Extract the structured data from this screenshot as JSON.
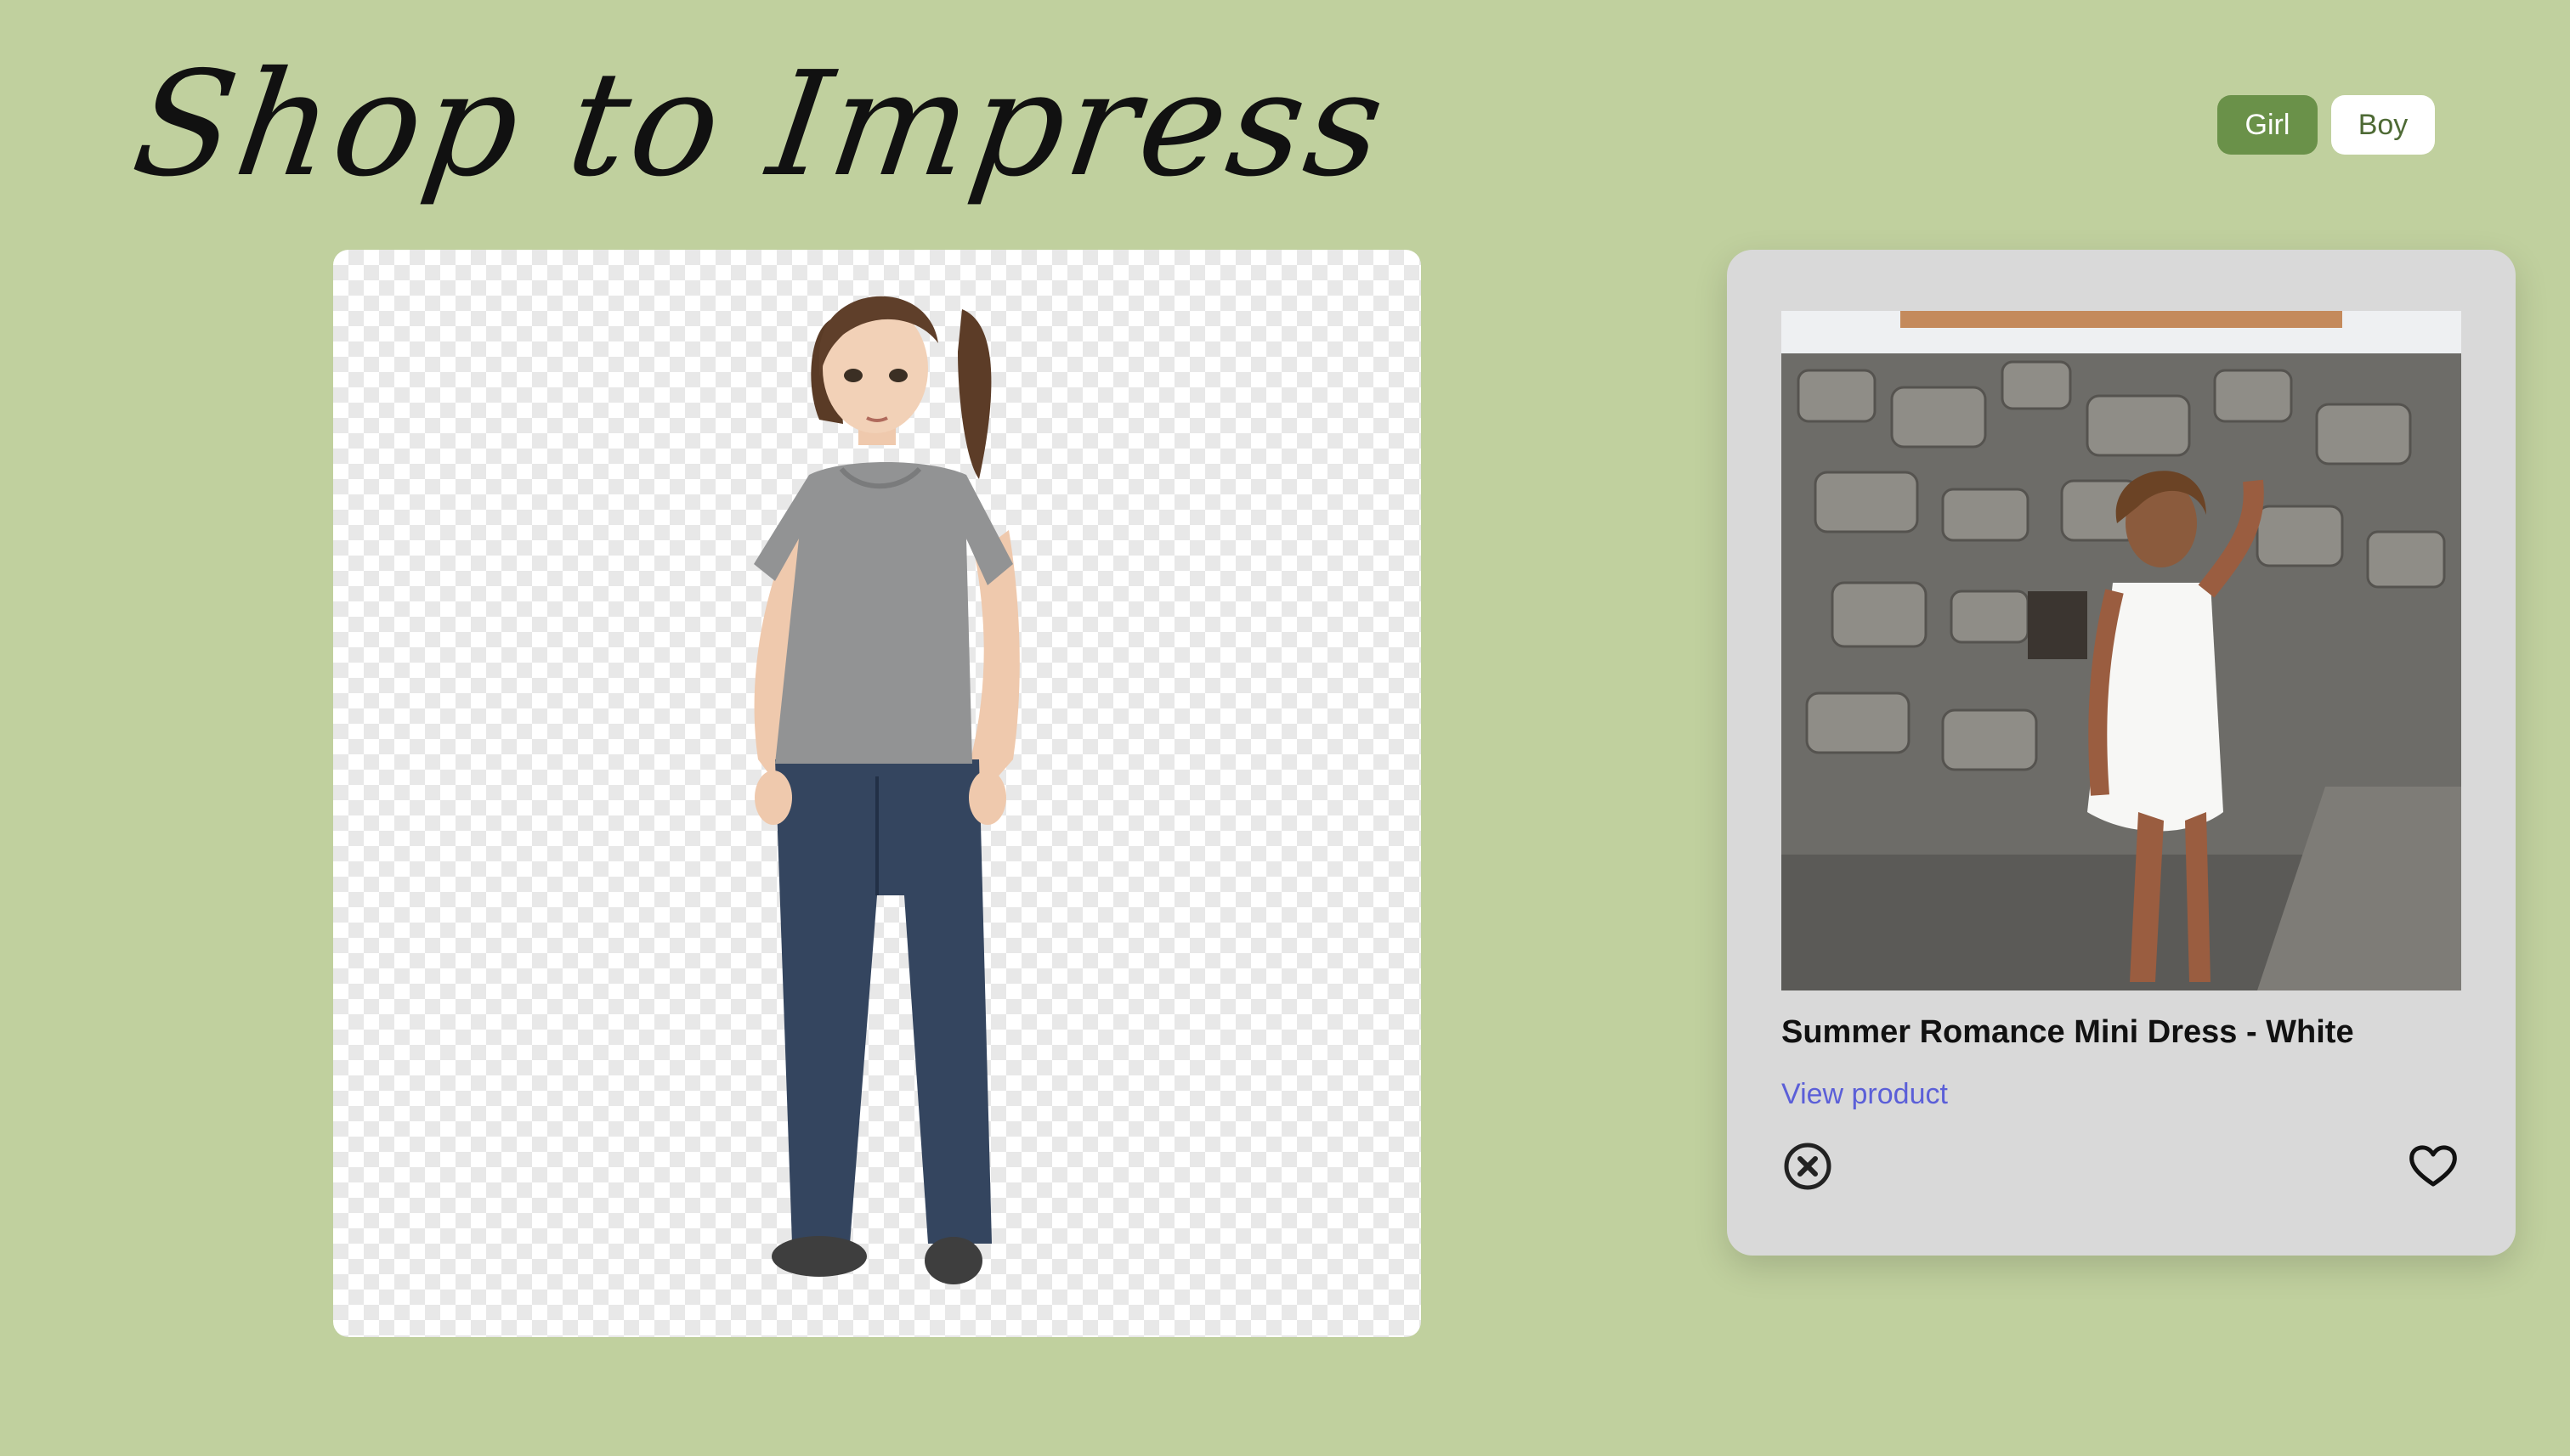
{
  "header": {
    "title": "Shop to Impress",
    "toggle": [
      {
        "label": "Girl",
        "active": true
      },
      {
        "label": "Boy",
        "active": false
      }
    ]
  },
  "avatar_canvas": {
    "content": "avatar-figure"
  },
  "product_card": {
    "name": "Summer Romance Mini Dress - White",
    "link_label": "View product",
    "dismiss_icon": "close-circle-icon",
    "favorite_icon": "heart-icon"
  },
  "colors": {
    "page_background": "#c0d09e",
    "toggle_active": "#6a9149",
    "card_background": "#d9d9d9",
    "link": "#5b5fd8"
  }
}
